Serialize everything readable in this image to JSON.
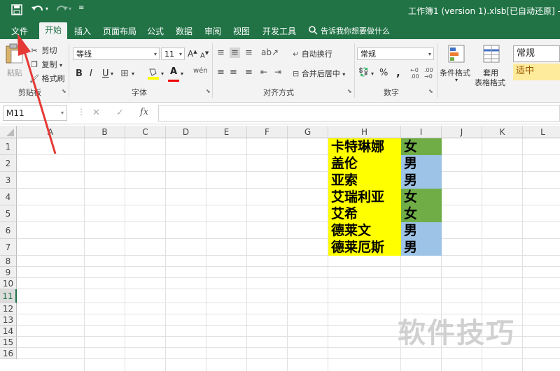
{
  "window": {
    "title": "工作簿1 (version 1).xlsb[已自动还原] - Exc"
  },
  "tabs": [
    {
      "label": "文件"
    },
    {
      "label": "开始"
    },
    {
      "label": "插入"
    },
    {
      "label": "页面布局"
    },
    {
      "label": "公式"
    },
    {
      "label": "数据"
    },
    {
      "label": "审阅"
    },
    {
      "label": "视图"
    },
    {
      "label": "开发工具"
    }
  ],
  "tell_me": "告诉我你想要做什么",
  "clipboard": {
    "paste": "粘贴",
    "cut": "剪切",
    "copy": "复制",
    "format_painter": "格式刷",
    "label": "剪贴板"
  },
  "font": {
    "name": "等线",
    "size": "11",
    "label": "字体",
    "bold": "B",
    "italic": "I",
    "underline": "U"
  },
  "alignment": {
    "wrap": "自动换行",
    "merge": "合并后居中",
    "label": "对齐方式"
  },
  "number": {
    "format": "常规",
    "label": "数字",
    "percent": "%",
    "comma": ","
  },
  "styles": {
    "conditional": "条件格式",
    "table_line1": "套用",
    "table_line2": "表格格式",
    "style_normal": "常规",
    "style_neutral": "适中"
  },
  "formula_bar": {
    "name_box": "M11",
    "cancel": "✕",
    "enter": "✓",
    "fx": "fx"
  },
  "columns": [
    "A",
    "B",
    "C",
    "D",
    "E",
    "F",
    "G",
    "H",
    "I",
    "J",
    "K",
    "L"
  ],
  "rows": [
    "1",
    "2",
    "3",
    "4",
    "5",
    "6",
    "7",
    "8",
    "9",
    "10",
    "11",
    "12",
    "13",
    "14",
    "15",
    "16"
  ],
  "cells": [
    {
      "name": "卡特琳娜",
      "gender": "女",
      "gender_color": "#70ad47"
    },
    {
      "name": "盖伦",
      "gender": "男",
      "gender_color": "#9dc3e6"
    },
    {
      "name": "亚索",
      "gender": "男",
      "gender_color": "#9dc3e6"
    },
    {
      "name": "艾瑞利亚",
      "gender": "女",
      "gender_color": "#70ad47"
    },
    {
      "name": "艾希",
      "gender": "女",
      "gender_color": "#70ad47"
    },
    {
      "name": "德莱文",
      "gender": "男",
      "gender_color": "#9dc3e6"
    },
    {
      "name": "德莱厄斯",
      "gender": "男",
      "gender_color": "#9dc3e6"
    }
  ],
  "name_fill_color": "#ffff00",
  "watermark": "软件技巧",
  "colors": {
    "excel_green": "#217346",
    "arrow": "#e53935"
  }
}
